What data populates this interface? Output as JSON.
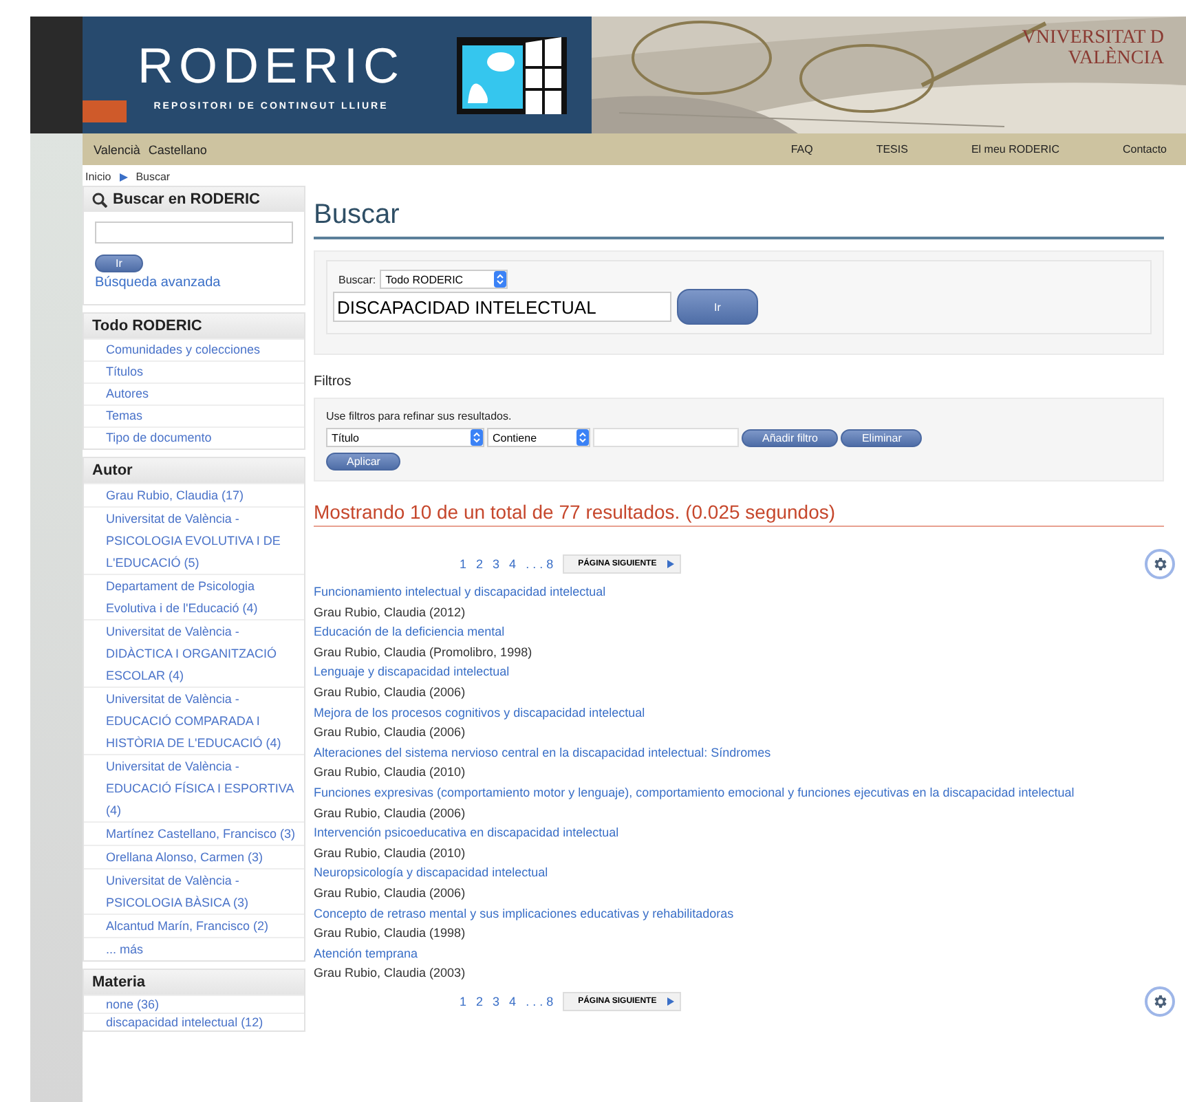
{
  "header": {
    "logo": "RODERIC",
    "tagline": "REPOSITORI DE CONTINGUT LLIURE",
    "university": [
      "VNIVERSITAT D",
      "VALÈNCIA"
    ]
  },
  "nav": {
    "languages": [
      "Valencià",
      "Castellano"
    ],
    "links": [
      "FAQ",
      "TESIS",
      "El meu RODERIC",
      "Contacto"
    ]
  },
  "breadcrumb": [
    "Inicio",
    "Buscar"
  ],
  "sidebar": {
    "search": {
      "title": "Buscar en RODERIC",
      "button": "Ir",
      "advanced": "Búsqueda avanzada"
    },
    "sections": [
      {
        "title": "Todo RODERIC",
        "items": [
          "Comunidades y colecciones",
          "Títulos",
          "Autores",
          "Temas",
          "Tipo de documento"
        ]
      },
      {
        "title": "Autor",
        "items": [
          "Grau Rubio, Claudia (17)",
          "Universitat de València - PSICOLOGIA EVOLUTIVA I DE L'EDUCACIÓ (5)",
          "Departament de Psicologia Evolutiva i de l'Educació (4)",
          "Universitat de València - DIDÀCTICA I ORGANITZACIÓ ESCOLAR (4)",
          "Universitat de València - EDUCACIÓ COMPARADA I HISTÒRIA DE L'EDUCACIÓ (4)",
          "Universitat de València - EDUCACIÓ FÍSICA I ESPORTIVA (4)",
          "Martínez Castellano, Francisco (3)",
          "Orellana Alonso, Carmen (3)",
          "Universitat de València - PSICOLOGIA BÀSICA (3)",
          "Alcantud Marín, Francisco (2)",
          "... más"
        ]
      },
      {
        "title": "Materia",
        "items": [
          "none (36)",
          "discapacidad intelectual (12)"
        ]
      }
    ]
  },
  "main": {
    "title": "Buscar",
    "search": {
      "scope_label": "Buscar:",
      "scope": "Todo RODERIC",
      "query": "DISCAPACIDAD INTELECTUAL",
      "button": "Ir"
    },
    "filters": {
      "title": "Filtros",
      "hint": "Use filtros para refinar sus resultados.",
      "field": "Título",
      "operator": "Contiene",
      "add": "Añadir filtro",
      "remove": "Eliminar",
      "apply": "Aplicar"
    },
    "summary": "Mostrando 10 de un total de 77 resultados. (0.025 segundos)",
    "pagination": [
      {
        "pages": [
          "1",
          "2",
          "3",
          "4"
        ],
        "ellipsis": ". . . 8",
        "next": "PÁGINA SIGUIENTE"
      },
      {
        "pages": [
          "1",
          "2",
          "3",
          "4"
        ],
        "ellipsis": ". . . 8",
        "next": "PÁGINA SIGUIENTE"
      }
    ],
    "results": [
      {
        "title": "Funcionamiento intelectual y discapacidad intelectual",
        "meta": "Grau Rubio, Claudia (2012)"
      },
      {
        "title": "Educación de la deficiencia mental",
        "meta": "Grau Rubio, Claudia (Promolibro, 1998)"
      },
      {
        "title": "Lenguaje y discapacidad intelectual",
        "meta": "Grau Rubio, Claudia (2006)"
      },
      {
        "title": "Mejora de los procesos cognitivos y discapacidad intelectual",
        "meta": "Grau Rubio, Claudia (2006)"
      },
      {
        "title": "Alteraciones del sistema nervioso central en la discapacidad intelectual: Síndromes",
        "meta": "Grau Rubio, Claudia (2010)"
      },
      {
        "title": "Funciones expresivas (comportamiento motor y lenguaje), comportamiento emocional y funciones ejecutivas en la discapacidad intelectual",
        "meta": "Grau Rubio, Claudia (2006)"
      },
      {
        "title": "Intervención psicoeducativa en discapacidad intelectual",
        "meta": "Grau Rubio, Claudia (2010)"
      },
      {
        "title": "Neuropsicología y discapacidad intelectual",
        "meta": "Grau Rubio, Claudia (2006)"
      },
      {
        "title": "Concepto de retraso mental y sus implicaciones educativas y rehabilitadoras",
        "meta": "Grau Rubio, Claudia (1998)"
      },
      {
        "title": "Atención temprana",
        "meta": "Grau Rubio, Claudia (2003)"
      }
    ]
  }
}
